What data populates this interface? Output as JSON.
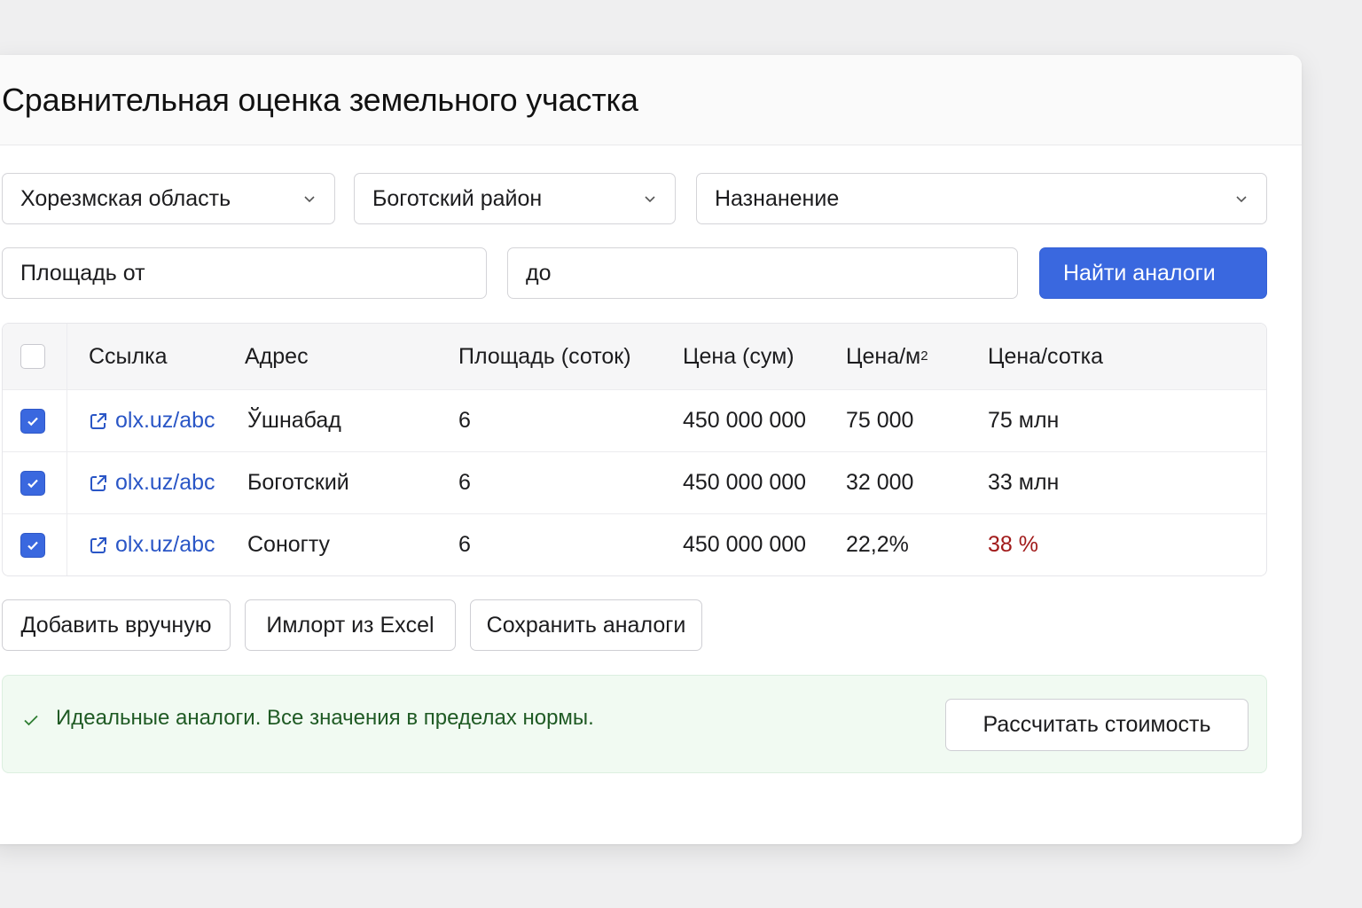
{
  "page": {
    "title": "Сравнительная оценка земельного участка"
  },
  "filters": {
    "region": "Хорезмская область",
    "district": "Боготский район",
    "purpose": "Назнанение",
    "area_from_placeholder": "Площадь от",
    "area_to_placeholder": "до",
    "search_button": "Найти аналоги"
  },
  "table": {
    "headers": {
      "link": "Ссылка",
      "address": "Адрес",
      "area": "Площадь (соток)",
      "price": "Цена (сум)",
      "price_m2": "Цена/м",
      "price_m2_sup": "2",
      "price_sotka": "Цена/сотка"
    },
    "rows": [
      {
        "checked": true,
        "link": "olx.uz/abc",
        "address": "Ўшнабад",
        "area": "6",
        "price": "450 000 000",
        "price_m2": "75 000",
        "price_sotka": "75 млн"
      },
      {
        "checked": true,
        "link": "olx.uz/abc",
        "address": "Боготский",
        "area": "6",
        "price": "450 000 000",
        "price_m2": "32 000",
        "price_sotka": "33 млн"
      },
      {
        "checked": true,
        "link": "olx.uz/abc",
        "address": "Соногту",
        "area": "6",
        "price": "450 000 000",
        "price_m2": "22,2%",
        "price_sotka": "38 %"
      }
    ]
  },
  "actions": {
    "add_manual": "Добавить вручную",
    "import_excel": "Имлорт из Excel",
    "save_analogs": "Сохранить аналоги"
  },
  "status": {
    "message": "Идеальные аналоги. Все значения в пределах нормы.",
    "calculate_button": "Рассчитать стоимость"
  },
  "colors": {
    "accent": "#3a68df",
    "link": "#2a56c6",
    "warning_red": "#a11a1a",
    "success_text": "#1f5a24",
    "success_bg": "#f1faf2"
  }
}
